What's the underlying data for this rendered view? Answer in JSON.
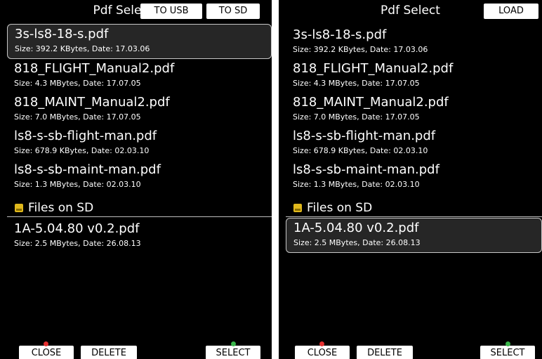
{
  "left": {
    "title": "Pdf Select",
    "top_buttons": {
      "to_usb": "TO USB",
      "to_sd": "TO SD"
    },
    "files": [
      {
        "name": "3s-ls8-18-s.pdf",
        "meta": "Size: 392.2 KBytes, Date: 17.03.06"
      },
      {
        "name": "818_FLIGHT_Manual2.pdf",
        "meta": "Size: 4.3 MBytes, Date: 17.07.05"
      },
      {
        "name": "818_MAINT_Manual2.pdf",
        "meta": "Size: 7.0 MBytes, Date: 17.07.05"
      },
      {
        "name": "ls8-s-sb-flight-man.pdf",
        "meta": "Size: 678.9 KBytes, Date: 02.03.10"
      },
      {
        "name": "ls8-s-sb-maint-man.pdf",
        "meta": "Size: 1.3 MBytes, Date: 02.03.10"
      }
    ],
    "section": {
      "label": "Files on SD",
      "icon": "sd-card-icon"
    },
    "sd_files": [
      {
        "name": "1A-5.04.80 v0.2.pdf",
        "meta": "Size: 2.5 MBytes, Date: 26.08.13"
      }
    ],
    "bottom_buttons": {
      "close": "CLOSE",
      "delete": "DELETE",
      "select": "SELECT"
    }
  },
  "right": {
    "title": "Pdf Select",
    "top_buttons": {
      "load": "LOAD"
    },
    "files": [
      {
        "name": "3s-ls8-18-s.pdf",
        "meta": "Size: 392.2 KBytes, Date: 17.03.06"
      },
      {
        "name": "818_FLIGHT_Manual2.pdf",
        "meta": "Size: 4.3 MBytes, Date: 17.07.05"
      },
      {
        "name": "818_MAINT_Manual2.pdf",
        "meta": "Size: 7.0 MBytes, Date: 17.07.05"
      },
      {
        "name": "ls8-s-sb-flight-man.pdf",
        "meta": "Size: 678.9 KBytes, Date: 02.03.10"
      },
      {
        "name": "ls8-s-sb-maint-man.pdf",
        "meta": "Size: 1.3 MBytes, Date: 02.03.10"
      }
    ],
    "section": {
      "label": "Files on SD",
      "icon": "sd-card-icon"
    },
    "sd_files": [
      {
        "name": "1A-5.04.80 v0.2.pdf",
        "meta": "Size: 2.5 MBytes, Date: 26.08.13"
      }
    ],
    "bottom_buttons": {
      "close": "CLOSE",
      "delete": "DELETE",
      "select": "SELECT"
    }
  },
  "colors": {
    "background": "#000000",
    "text": "#ffffff",
    "sd_icon": "#e0b81c",
    "close_dot": "#e53030",
    "select_dot": "#39b54a"
  }
}
